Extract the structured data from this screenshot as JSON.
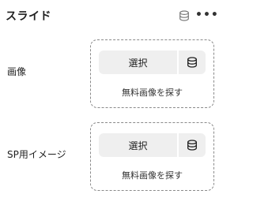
{
  "panel": {
    "title": "スライド"
  },
  "icons": {
    "header_db": "database-icon",
    "more": "more-horizontal-icon",
    "button_db": "database-icon"
  },
  "fields": [
    {
      "label": "画像",
      "select_label": "選択",
      "find_label": "無料画像を探す"
    },
    {
      "label": "SP用イメージ",
      "select_label": "選択",
      "find_label": "無料画像を探す"
    }
  ]
}
